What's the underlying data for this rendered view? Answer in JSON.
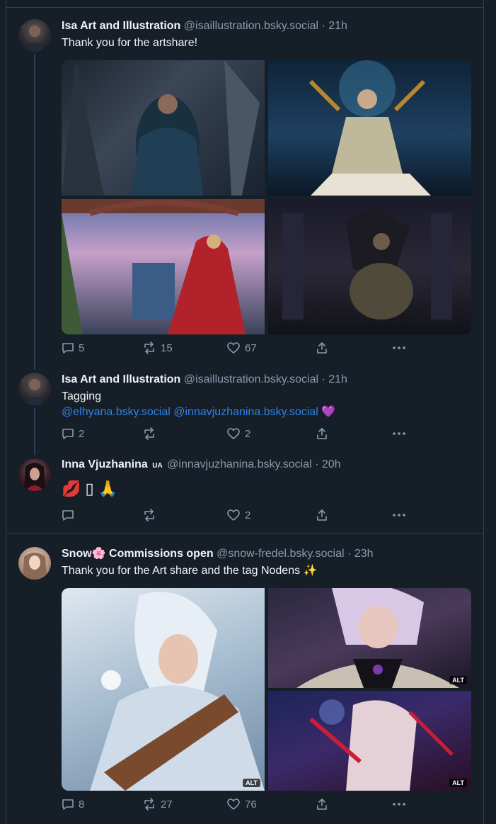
{
  "posts": [
    {
      "name": "Isa Art and Illustration",
      "handle": "@isaillustration.bsky.social",
      "time": "21h",
      "text": "Thank you for the artshare!",
      "replies": "5",
      "reposts": "15",
      "likes": "67"
    },
    {
      "name": "Isa Art and Illustration",
      "handle": "@isaillustration.bsky.social",
      "time": "21h",
      "text": "Tagging",
      "mention1": "@elhyana.bsky.social",
      "mention2": "@innavjuzhanina.bsky.social",
      "emoji": "💜",
      "replies": "2",
      "likes": "2"
    },
    {
      "name": "Inna Vjuzhanina",
      "badge": "UA",
      "handle": "@innavjuzhanina.bsky.social",
      "time": "20h",
      "text": "💋 ▯ 🙏",
      "likes": "2"
    },
    {
      "name": "Snow",
      "name_emoji": "🌸",
      "name_suffix": "Commissions open",
      "handle": "@snow-fredel.bsky.social",
      "time": "23h",
      "text": "Thank you for the Art share and the tag Nodens ✨",
      "replies": "8",
      "reposts": "27",
      "likes": "76",
      "alt_label": "ALT"
    }
  ],
  "separator": "·",
  "colors": {
    "background": "#161e27",
    "muted": "#8a9bac",
    "link": "#2f84e8",
    "border": "#2e4052"
  }
}
